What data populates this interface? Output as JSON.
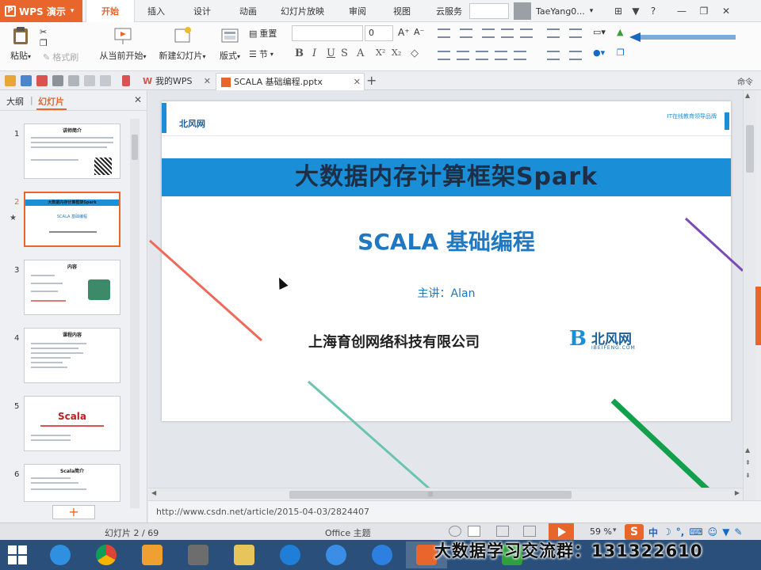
{
  "app": {
    "name": "WPS 演示"
  },
  "menu": {
    "tabs": [
      {
        "label": "开始",
        "active": true
      },
      {
        "label": "插入"
      },
      {
        "label": "设计"
      },
      {
        "label": "动画"
      },
      {
        "label": "幻灯片放映"
      },
      {
        "label": "审阅"
      },
      {
        "label": "视图"
      },
      {
        "label": "云服务"
      }
    ]
  },
  "user": {
    "name": "TaeYang0..."
  },
  "ribbon": {
    "paste_label": "粘贴",
    "format_painter_label": "格式刷",
    "from_current_label": "从当前开始",
    "new_slide_label": "新建幻灯片",
    "layout_label": "版式",
    "reset_label": "重置",
    "section_label": "节",
    "font_size": "0"
  },
  "doc_tabs": [
    {
      "label": "我的WPS"
    },
    {
      "label": "SCALA 基础编程.pptx",
      "active": true
    }
  ],
  "toolbar_right_label": "命令",
  "left_panel": {
    "outline_tab": "大纲",
    "slides_tab": "幻灯片",
    "thumbnails": [
      {
        "num": "1",
        "title": "讲师简介"
      },
      {
        "num": "2",
        "title": "大数据内存计算框架Spark",
        "selected": true
      },
      {
        "num": "3",
        "title": "内容"
      },
      {
        "num": "4",
        "title": "课程内容"
      },
      {
        "num": "5",
        "title": "Scala"
      },
      {
        "num": "6",
        "title": "Scala简介"
      }
    ]
  },
  "slide": {
    "slogan": "IT在线教育领导品牌",
    "title": "大数据内存计算框架Spark",
    "subtitle": "SCALA 基础编程",
    "presenter": "主讲：Alan",
    "company": "上海育创网络科技有限公司",
    "logo_name": "北风网",
    "logo_domain": "IBEIFENG.COM"
  },
  "notes": {
    "text": "http://www.csdn.net/article/2015-04-03/2824407"
  },
  "status": {
    "slide_counter": "幻灯片 2 / 69",
    "theme": "Office 主题",
    "zoom": "59 %"
  },
  "ime": {
    "logo": "S",
    "mode": "中"
  },
  "watermark": "大数据学习交流群：131322610",
  "colors": {
    "accent": "#e8662c",
    "slide_blue": "#1a8fd8",
    "taskbar": "#2a4f7a"
  }
}
